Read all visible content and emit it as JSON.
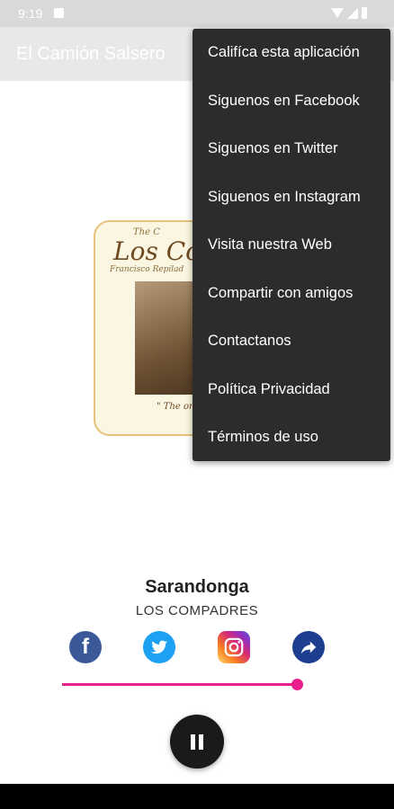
{
  "status_bar": {
    "time": "9:19"
  },
  "app_bar": {
    "title": "El Camión Salsero"
  },
  "overflow_menu": {
    "items": [
      "Califíca esta aplicación",
      "Siguenos en Facebook",
      "Siguenos en Twitter",
      "Siguenos en Instagram",
      "Visita nuestra Web",
      "Compartir con amigos",
      "Contactanos",
      "Política Privacidad",
      "Términos de uso"
    ]
  },
  "album_art": {
    "top_text": "The C",
    "title": "Los Com",
    "subtitle": "Francisco Repilad",
    "bottom_text": "\" The ori"
  },
  "now_playing": {
    "title": "Sarandonga",
    "artist": "LOS COMPADRES",
    "progress": 0.98
  },
  "social": {
    "facebook_glyph": "f",
    "icons": [
      "facebook-icon",
      "twitter-icon",
      "instagram-icon",
      "share-icon"
    ]
  },
  "colors": {
    "accent": "#e91e8c",
    "menu_bg": "#2c2c2c",
    "facebook": "#3b5998",
    "twitter": "#1da1f2",
    "share": "#1e3f8f"
  }
}
